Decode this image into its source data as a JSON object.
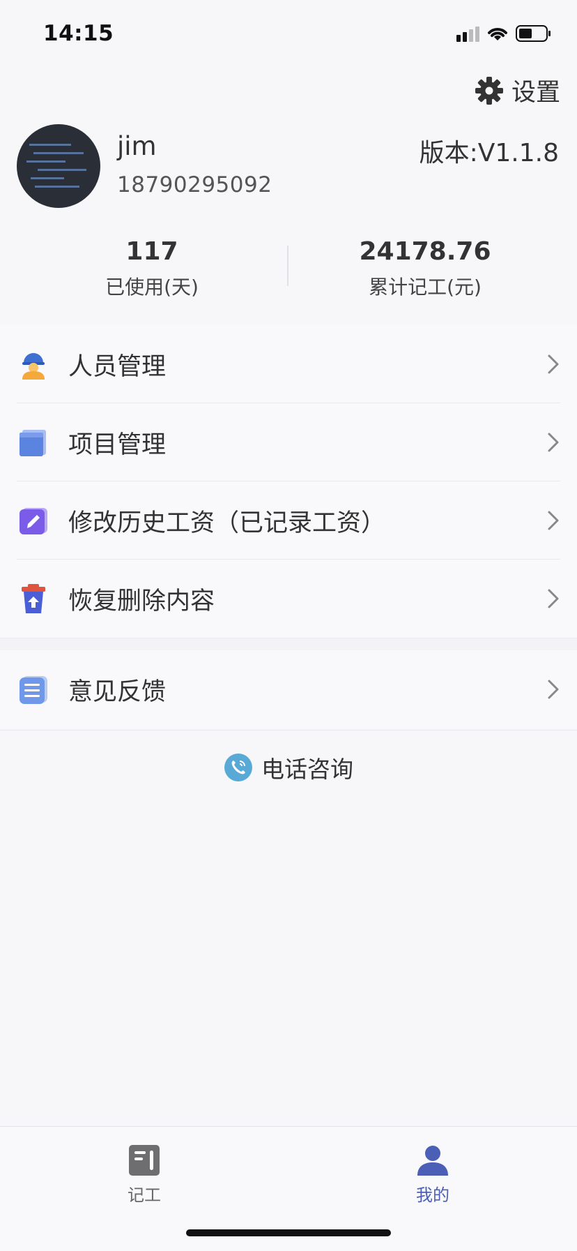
{
  "status_bar": {
    "time": "14:15"
  },
  "settings": {
    "label": "设置"
  },
  "profile": {
    "name": "jim",
    "phone": "18790295092",
    "version": "版本:V1.1.8"
  },
  "stats": [
    {
      "value": "117",
      "label": "已使用(天)"
    },
    {
      "value": "24178.76",
      "label": "累计记工(元)"
    }
  ],
  "menu": {
    "items": [
      {
        "label": "人员管理",
        "icon": "worker-helmet-icon"
      },
      {
        "label": "项目管理",
        "icon": "folder-icon"
      },
      {
        "label": "修改历史工资（已记录工资）",
        "icon": "edit-pencil-icon"
      },
      {
        "label": "恢复删除内容",
        "icon": "restore-bin-icon"
      }
    ],
    "feedback": {
      "label": "意见反馈",
      "icon": "feedback-list-icon"
    }
  },
  "consult": {
    "label": "电话咨询",
    "icon": "phone-call-icon"
  },
  "tab_bar": {
    "tabs": [
      {
        "label": "记工",
        "icon": "record-work-icon",
        "active": false
      },
      {
        "label": "我的",
        "icon": "user-profile-icon",
        "active": true
      }
    ]
  },
  "colors": {
    "accent": "#4a5fb5",
    "background": "#f7f7f9",
    "text": "#333333"
  }
}
